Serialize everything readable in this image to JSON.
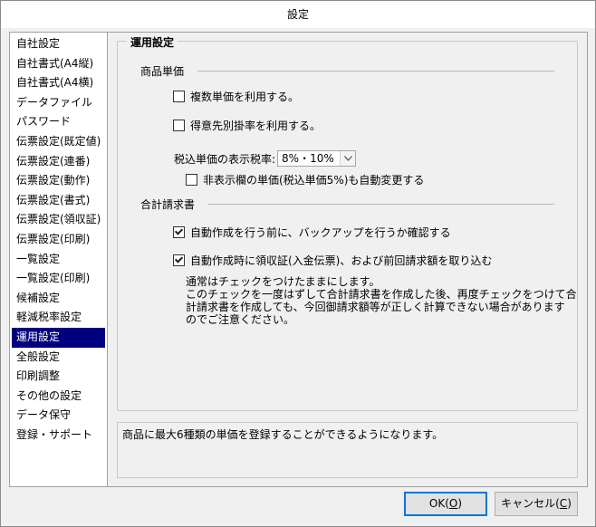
{
  "window": {
    "title": "設定"
  },
  "sidebar": {
    "items": [
      {
        "label": "自社設定"
      },
      {
        "label": "自社書式(A4縦)"
      },
      {
        "label": "自社書式(A4横)"
      },
      {
        "label": "データファイル"
      },
      {
        "label": "パスワード"
      },
      {
        "label": "伝票設定(既定値)"
      },
      {
        "label": "伝票設定(連番)"
      },
      {
        "label": "伝票設定(動作)"
      },
      {
        "label": "伝票設定(書式)"
      },
      {
        "label": "伝票設定(領収証)"
      },
      {
        "label": "伝票設定(印刷)"
      },
      {
        "label": "一覧設定"
      },
      {
        "label": "一覧設定(印刷)"
      },
      {
        "label": "候補設定"
      },
      {
        "label": "軽減税率設定"
      },
      {
        "label": "運用設定",
        "selected": true
      },
      {
        "label": "全般設定"
      },
      {
        "label": "印刷調整"
      },
      {
        "label": "その他の設定"
      },
      {
        "label": "データ保守"
      },
      {
        "label": "登録・サポート"
      }
    ]
  },
  "group": {
    "title": "運用設定",
    "price_section": {
      "heading": "商品単価",
      "multi_price": {
        "label": "複数単価を利用する。",
        "checked": false
      },
      "customer_rate": {
        "label": "得意先別掛率を利用する。",
        "checked": false
      },
      "tax_rate_label": "税込単価の表示税率:",
      "tax_rate_value": "8%・10%",
      "auto_change": {
        "label": "非表示欄の単価(税込単価5%)も自動変更する",
        "checked": false
      }
    },
    "invoice_section": {
      "heading": "合計請求書",
      "backup_confirm": {
        "label": "自動作成を行う前に、バックアップを行うか確認する",
        "checked": true
      },
      "include_receipts": {
        "label": "自動作成時に領収証(入金伝票)、および前回請求額を取り込む",
        "checked": true
      },
      "note_lines": [
        "通常はチェックをつけたままにします。",
        "このチェックを一度はずして合計請求書を作成した後、再度チェックをつけて合",
        "計請求書を作成しても、今回御請求額等が正しく計算できない場合があります",
        "のでご注意ください。"
      ]
    }
  },
  "description": "商品に最大6種類の単価を登録することができるようになります。",
  "buttons": {
    "ok": {
      "label": "OK(",
      "key": "O",
      "suffix": ")"
    },
    "cancel": {
      "label": "キャンセル(",
      "key": "C",
      "suffix": ")"
    }
  },
  "colors": {
    "selection": "#000080",
    "accent": "#0078d7"
  }
}
